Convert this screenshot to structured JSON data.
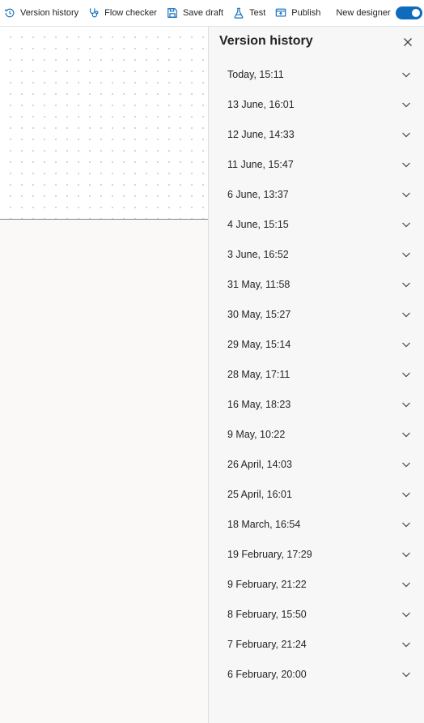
{
  "toolbar": {
    "version_history": "Version history",
    "flow_checker": "Flow checker",
    "save_draft": "Save draft",
    "test": "Test",
    "publish": "Publish",
    "new_designer": "New designer",
    "new_designer_on": true
  },
  "panel": {
    "title": "Version history",
    "items": [
      "Today, 15:11",
      "13 June, 16:01",
      "12 June, 14:33",
      "11 June, 15:47",
      "6 June, 13:37",
      "4 June, 15:15",
      "3 June, 16:52",
      "31 May, 11:58",
      "30 May, 15:27",
      "29 May, 15:14",
      "28 May, 17:11",
      "16 May, 18:23",
      "9 May, 10:22",
      "26 April, 14:03",
      "25 April, 16:01",
      "18 March, 16:54",
      "19 February, 17:29",
      "9 February, 21:22",
      "8 February, 15:50",
      "7 February, 21:24",
      "6 February, 20:00"
    ]
  },
  "colors": {
    "accent": "#0f6cbd",
    "panel_bg": "#f7f7f7",
    "canvas_bg": "#ffffff"
  },
  "icons": [
    "history-icon",
    "stethoscope-icon",
    "save-icon",
    "flask-icon",
    "publish-icon",
    "close-icon",
    "chevron-down-icon"
  ]
}
